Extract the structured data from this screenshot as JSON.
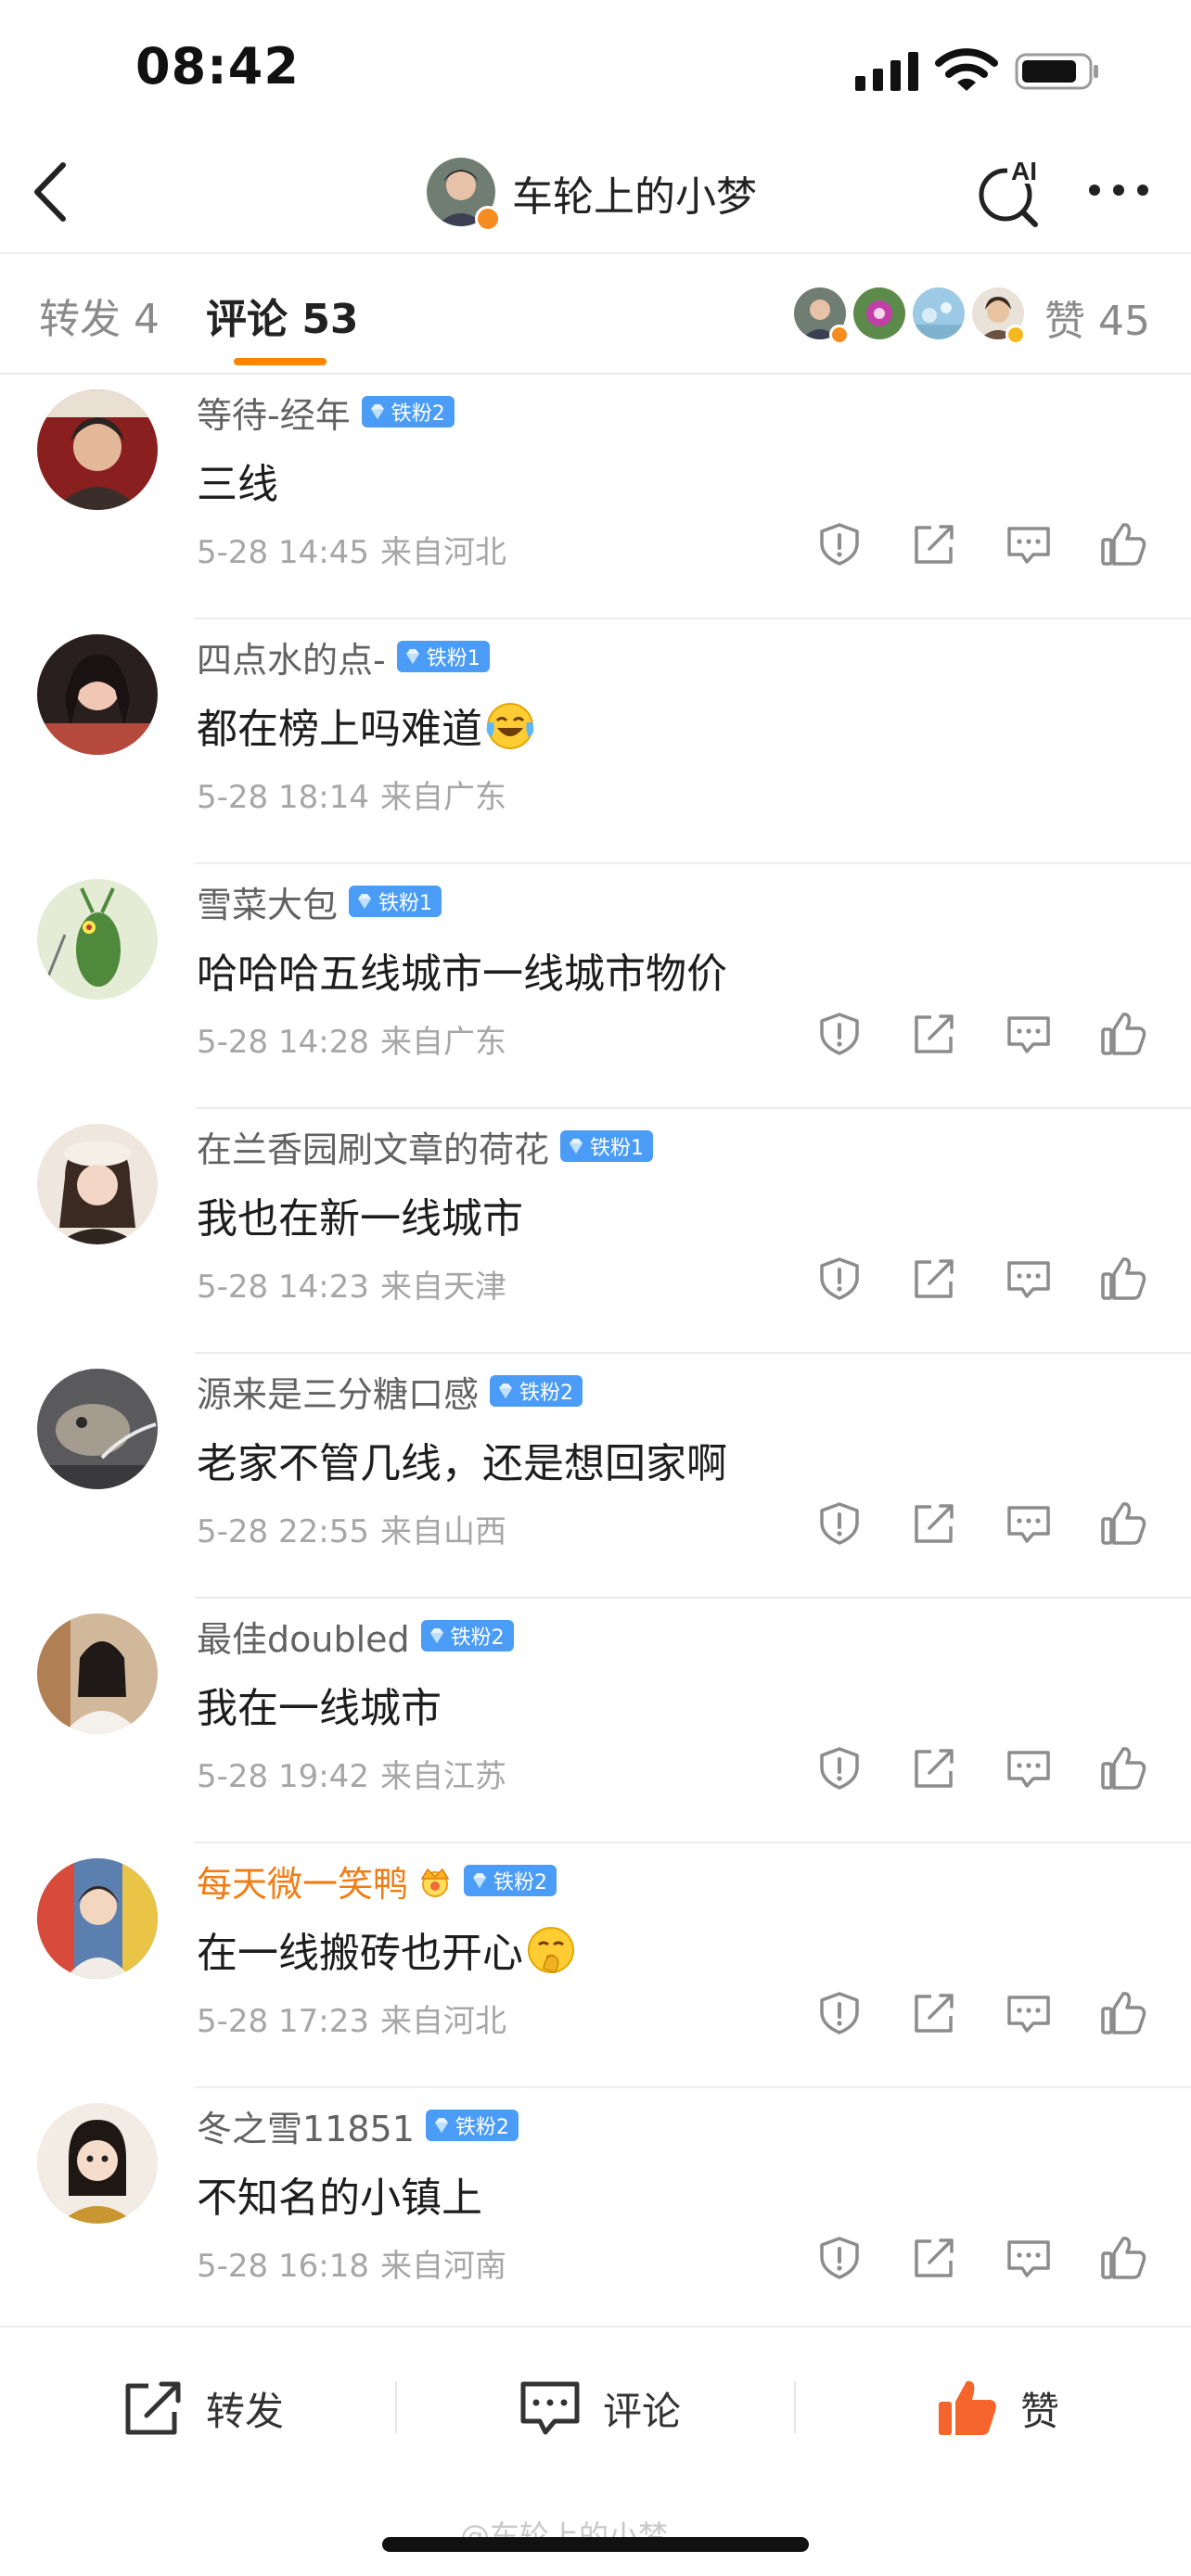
{
  "status_bar": {
    "time": "08:42"
  },
  "header": {
    "title": "车轮上的小梦",
    "ai_label": "AI"
  },
  "tabs": {
    "repost": "转发 4",
    "comments": "评论 53",
    "likes": "赞 45"
  },
  "comments": [
    {
      "name": "等待-经年",
      "badge": "铁粉2",
      "text": "三线",
      "date": "5-28 14:45",
      "location": "来自河北",
      "actions": true
    },
    {
      "name": "四点水的点-",
      "badge": "铁粉1",
      "text": "都在榜上吗难道",
      "emoji": "laugh-cry",
      "date": "5-28 18:14",
      "location": "来自广东",
      "actions": false
    },
    {
      "name": "雪菜大包",
      "badge": "铁粉1",
      "text": "哈哈哈五线城市一线城市物价",
      "date": "5-28 14:28",
      "location": "来自广东",
      "actions": true
    },
    {
      "name": "在兰香园刷文章的荷花",
      "badge": "铁粉1",
      "text": "我也在新一线城市",
      "date": "5-28 14:23",
      "location": "来自天津",
      "actions": true
    },
    {
      "name": "源来是三分糖口感",
      "badge": "铁粉2",
      "text": "老家不管几线，还是想回家啊",
      "date": "5-28 22:55",
      "location": "来自山西",
      "actions": true
    },
    {
      "name": "最佳doubled",
      "badge": "铁粉2",
      "text": "我在一线城市",
      "date": "5-28 19:42",
      "location": "来自江苏",
      "actions": true
    },
    {
      "name": "每天微一笑鸭",
      "badge": "铁粉2",
      "vip": true,
      "text": "在一线搬砖也开心",
      "emoji": "shush",
      "date": "5-28 17:23",
      "location": "来自河北",
      "actions": true
    },
    {
      "name": "冬之雪11851",
      "badge": "铁粉2",
      "text": "不知名的小镇上",
      "date": "5-28 16:18",
      "location": "来自河南",
      "actions": true
    }
  ],
  "bottom_bar": {
    "repost": "转发",
    "comment": "评论",
    "like": "赞"
  },
  "watermark": "@车轮上的小梦",
  "colors": {
    "accent": "#ff8200",
    "fan_badge": "#4a9cf6",
    "vip_name": "#f27c13",
    "like": "#f5642a"
  },
  "icons": [
    "back-icon",
    "ai-search-icon",
    "more-icon",
    "report-icon",
    "share-icon",
    "reply-icon",
    "like-icon"
  ]
}
